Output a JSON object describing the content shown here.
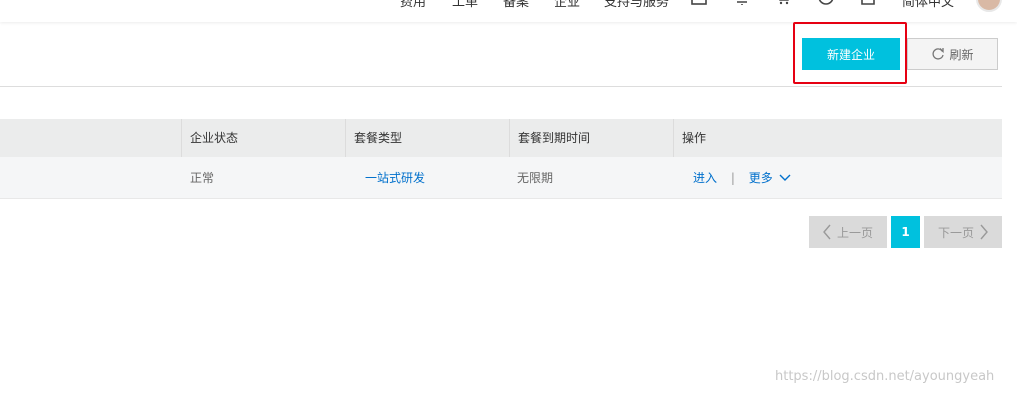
{
  "topnav": {
    "items": [
      "费用",
      "工单",
      "备案",
      "企业",
      "支持与服务"
    ],
    "language": "简体中文"
  },
  "toolbar": {
    "new_button": "新建企业",
    "refresh_button": "刷新"
  },
  "table": {
    "headers": [
      "企业状态",
      "套餐类型",
      "套餐到期时间",
      "操作"
    ],
    "rows": [
      {
        "status": "正常",
        "package": "一站式研发",
        "expiry": "无限期",
        "enter": "进入",
        "separator": "|",
        "more": "更多"
      }
    ]
  },
  "pagination": {
    "prev": "上一页",
    "current": "1",
    "next": "下一页"
  },
  "watermark": "https://blog.csdn.net/ayoungyeah",
  "colors": {
    "primary": "#00c1de",
    "link": "#0070cc",
    "highlight": "#e60012"
  }
}
